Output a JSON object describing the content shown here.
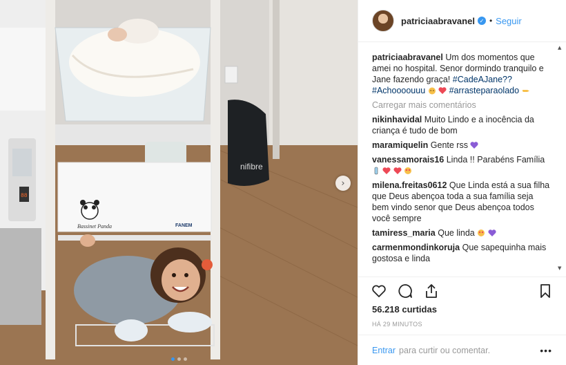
{
  "post": {
    "author": "patriciaabravanel",
    "follow_label": "Seguir",
    "separator": "•",
    "caption_text": "Um dos momentos que amei no hospital. Senor dormindo tranquilo e Jane fazendo graça!",
    "caption_tags": "#CadeAJane?? #Achoooouuu",
    "caption_tag2": "#arrasteparaolado",
    "photo_brand_1": "Bassinet Panda",
    "photo_brand_2": "FANEM",
    "photo_bag_text": "nifibre",
    "next_icon": "chevron-right-icon"
  },
  "comments": {
    "load_more": "Carregar mais comentários",
    "items": [
      {
        "user": "nikinhavidal",
        "text": "Muito Lindo e a inocência da criança é tudo de bom"
      },
      {
        "user": "maramiquelin",
        "text": "Gente rss"
      },
      {
        "user": "vanessamorais16",
        "text": "Linda !! Parabéns Família"
      },
      {
        "user": "milena.freitas0612",
        "text": "Que Linda está a sua filha que Deus abençoa toda a sua família seja bem vindo senor que Deus abençoa todos você sempre"
      },
      {
        "user": "tamiress_maria",
        "text": "Que linda"
      },
      {
        "user": "carmenmondinkoruja",
        "text": "Que sapequinha mais gostosa e linda"
      }
    ]
  },
  "stats": {
    "likes": "56.218 curtidas",
    "time_ago": "HÁ 29 MINUTOS"
  },
  "footer": {
    "login": "Entrar",
    "rest": "para curtir ou comentar.",
    "more": "•••"
  },
  "colors": {
    "link_blue": "#3897f0",
    "tag_blue": "#003569",
    "muted": "#999999",
    "heart_red": "#ed4956",
    "purple_heart": "#8a5cd6"
  }
}
